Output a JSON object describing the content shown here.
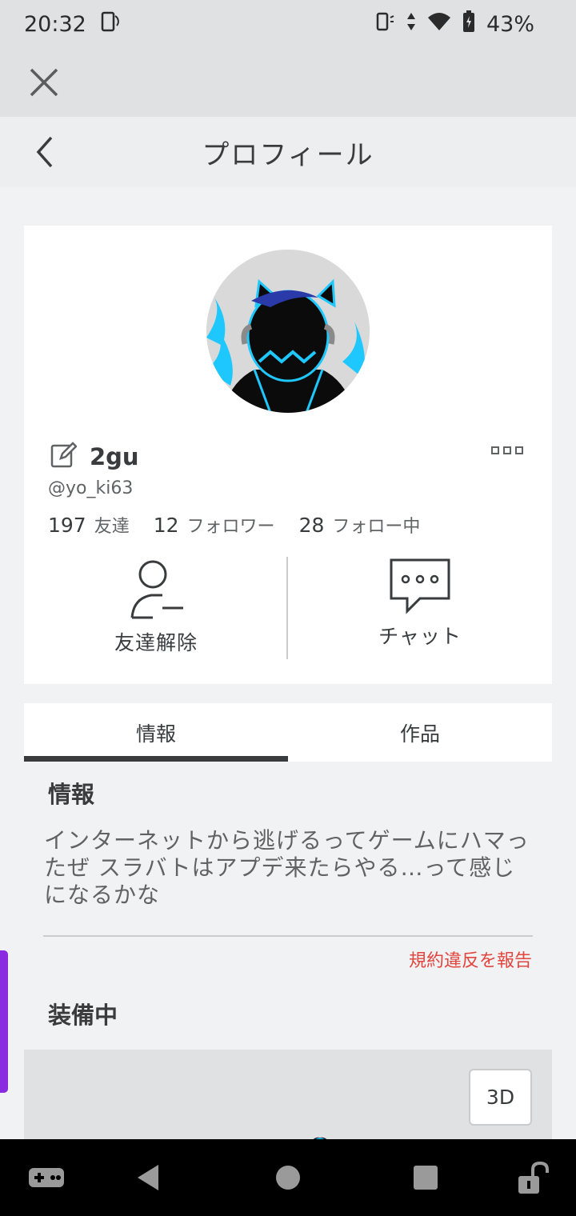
{
  "status_bar": {
    "time": "20:32",
    "battery": "43%"
  },
  "header": {
    "title": "プロフィール"
  },
  "profile": {
    "display_name": "2gu",
    "username": "@yo_ki63",
    "stats": [
      {
        "value": "197",
        "label": "友達"
      },
      {
        "value": "12",
        "label": "フォロワー"
      },
      {
        "value": "28",
        "label": "フォロー中"
      }
    ],
    "actions": {
      "unfriend_label": "友達解除",
      "chat_label": "チャット"
    }
  },
  "tabs": [
    {
      "label": "情報",
      "active": true
    },
    {
      "label": "作品",
      "active": false
    }
  ],
  "about": {
    "title": "情報",
    "text": "インターネットから逃げるってゲームにハマったぜ スラバトはアプデ来たらやる…って感じになるかな",
    "report_label": "規約違反を報告"
  },
  "equipped": {
    "title": "装備中",
    "view_3d_label": "3D"
  },
  "colors": {
    "report": "#e2463f",
    "scroll_indicator": "#8a2be2",
    "avatar_accent": "#1ec8ff"
  }
}
